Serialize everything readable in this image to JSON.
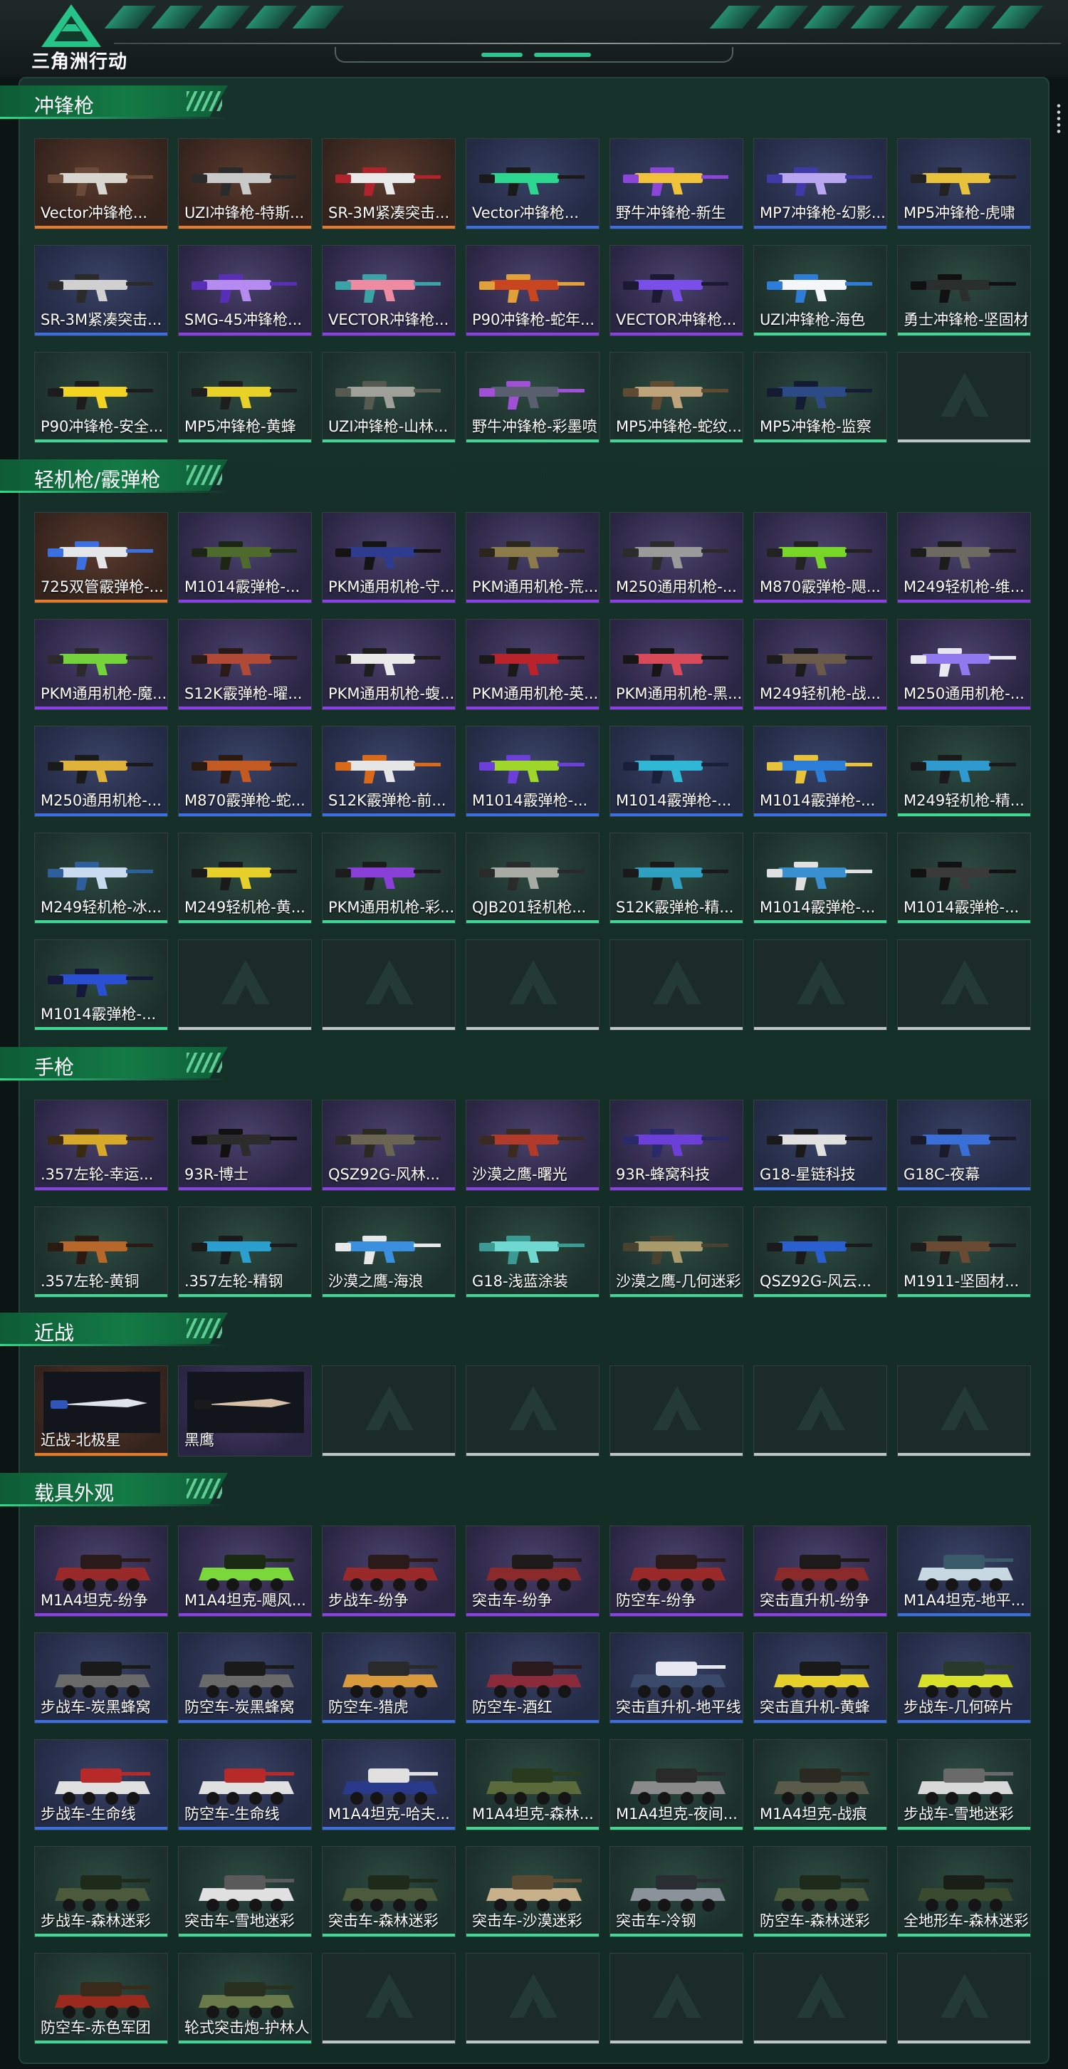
{
  "app": {
    "title": "三角洲行动"
  },
  "colors": {
    "purple": "#8a3fe8",
    "blue": "#3a6fe4",
    "green": "#3ed793",
    "orange": "#e57b2b",
    "accent": "#137a45"
  },
  "sections": [
    {
      "title": "冲锋枪",
      "type": "gun",
      "items": [
        {
          "label": "Vector冲锋枪...",
          "rarity": "orange",
          "palette": [
            "#d8d6cf",
            "#6b4a3a"
          ]
        },
        {
          "label": "UZI冲锋枪-特斯...",
          "rarity": "orange",
          "palette": [
            "#c9c9c9",
            "#2b2b2b"
          ]
        },
        {
          "label": "SR-3M紧凑突击...",
          "rarity": "orange",
          "palette": [
            "#e8e8e8",
            "#b0232a"
          ]
        },
        {
          "label": "Vector冲锋枪...",
          "rarity": "blue",
          "palette": [
            "#2dd68f",
            "#1a1a1a"
          ]
        },
        {
          "label": "野牛冲锋枪-新生",
          "rarity": "blue",
          "palette": [
            "#f0c23a",
            "#8b45d8"
          ]
        },
        {
          "label": "MP7冲锋枪-幻影...",
          "rarity": "blue",
          "palette": [
            "#b8a6f0",
            "#3f3aa8"
          ]
        },
        {
          "label": "MP5冲锋枪-虎啸",
          "rarity": "blue",
          "palette": [
            "#e9c23b",
            "#222222"
          ]
        },
        {
          "label": "SR-3M紧凑突击...",
          "rarity": "blue",
          "palette": [
            "#d0d0d0",
            "#2a2a2a"
          ]
        },
        {
          "label": "SMG-45冲锋枪...",
          "rarity": "purple",
          "palette": [
            "#b58bf2",
            "#5a2fb8"
          ]
        },
        {
          "label": "VECTOR冲锋枪...",
          "rarity": "purple",
          "palette": [
            "#ef8aa3",
            "#3aa3a8"
          ]
        },
        {
          "label": "P90冲锋枪-蛇年...",
          "rarity": "purple",
          "palette": [
            "#c8461f",
            "#e2a03a"
          ]
        },
        {
          "label": "VECTOR冲锋枪...",
          "rarity": "purple",
          "palette": [
            "#7a4ee8",
            "#1c1a33"
          ]
        },
        {
          "label": "UZI冲锋枪-海色",
          "rarity": "green",
          "palette": [
            "#f4f6f8",
            "#2e7bd8"
          ]
        },
        {
          "label": "勇士冲锋枪-坚固材...",
          "rarity": "green",
          "palette": [
            "#2a2e2c",
            "#111111"
          ]
        },
        {
          "label": "P90冲锋枪-安全...",
          "rarity": "green",
          "palette": [
            "#f3d322",
            "#1c1c1c"
          ]
        },
        {
          "label": "MP5冲锋枪-黄蜂",
          "rarity": "green",
          "palette": [
            "#e8d228",
            "#1e1e1e"
          ]
        },
        {
          "label": "UZI冲锋枪-山林...",
          "rarity": "green",
          "palette": [
            "#9fa09a",
            "#565a50"
          ]
        },
        {
          "label": "野牛冲锋枪-彩墨喷...",
          "rarity": "green",
          "palette": [
            "#5a5f70",
            "#a24fd8"
          ]
        },
        {
          "label": "MP5冲锋枪-蛇纹...",
          "rarity": "green",
          "palette": [
            "#bfa47b",
            "#5f4a32"
          ]
        },
        {
          "label": "MP5冲锋枪-监察",
          "rarity": "green",
          "palette": [
            "#2c4a86",
            "#131c33"
          ]
        },
        {
          "label": "",
          "rarity": "empty"
        }
      ]
    },
    {
      "title": "轻机枪/霰弹枪",
      "type": "gun",
      "items": [
        {
          "label": "725双管霰弹枪-...",
          "rarity": "orange",
          "palette": [
            "#e4e6ea",
            "#3c6fe0"
          ]
        },
        {
          "label": "M1014霰弹枪-...",
          "rarity": "purple",
          "palette": [
            "#4f6a2d",
            "#1d2615"
          ]
        },
        {
          "label": "PKM通用机枪-守...",
          "rarity": "purple",
          "palette": [
            "#2e3b8f",
            "#141414"
          ]
        },
        {
          "label": "PKM通用机枪-荒...",
          "rarity": "purple",
          "palette": [
            "#8b7a4a",
            "#2a261c"
          ]
        },
        {
          "label": "M250通用机枪-...",
          "rarity": "purple",
          "palette": [
            "#9a9a9a",
            "#2b2b2b"
          ]
        },
        {
          "label": "M870霰弹枪-飓...",
          "rarity": "purple",
          "palette": [
            "#78d628",
            "#222222"
          ]
        },
        {
          "label": "M249轻机枪-维...",
          "rarity": "purple",
          "palette": [
            "#6d6a62",
            "#1c1c1c"
          ]
        },
        {
          "label": "PKM通用机枪-魔...",
          "rarity": "purple",
          "palette": [
            "#74d23a",
            "#2a2a2a"
          ]
        },
        {
          "label": "S12K霰弹枪-曜...",
          "rarity": "purple",
          "palette": [
            "#b04a36",
            "#2a1a18"
          ]
        },
        {
          "label": "PKM通用机枪-蝮...",
          "rarity": "purple",
          "palette": [
            "#e9e9e9",
            "#1e1e1e"
          ]
        },
        {
          "label": "PKM通用机枪-英...",
          "rarity": "purple",
          "palette": [
            "#b8232c",
            "#1a1a1a"
          ]
        },
        {
          "label": "PKM通用机枪-黑...",
          "rarity": "purple",
          "palette": [
            "#d84a5a",
            "#161616"
          ]
        },
        {
          "label": "M249轻机枪-战...",
          "rarity": "purple",
          "palette": [
            "#6a5a4a",
            "#1b1b1b"
          ]
        },
        {
          "label": "M250通用机枪-...",
          "rarity": "purple",
          "palette": [
            "#8f7af0",
            "#e8e8f0"
          ]
        },
        {
          "label": "M250通用机枪-...",
          "rarity": "blue",
          "palette": [
            "#e0b23a",
            "#1a1a1a"
          ]
        },
        {
          "label": "M870霰弹枪-蛇...",
          "rarity": "blue",
          "palette": [
            "#c25a22",
            "#2a1a12"
          ]
        },
        {
          "label": "S12K霰弹枪-前...",
          "rarity": "blue",
          "palette": [
            "#e6e6e6",
            "#d86a1a"
          ]
        },
        {
          "label": "M1014霰弹枪-...",
          "rarity": "blue",
          "palette": [
            "#9ed62a",
            "#6b3fd8"
          ]
        },
        {
          "label": "M1014霰弹枪-...",
          "rarity": "blue",
          "palette": [
            "#2fb8d6",
            "#1a1f3a"
          ]
        },
        {
          "label": "M1014霰弹枪-...",
          "rarity": "blue",
          "palette": [
            "#2b7ed8",
            "#e8c23a"
          ]
        },
        {
          "label": "M249轻机枪-精...",
          "rarity": "green",
          "palette": [
            "#2f9ad0",
            "#1a1a1a"
          ]
        },
        {
          "label": "M249轻机枪-冰...",
          "rarity": "green",
          "palette": [
            "#c9dcef",
            "#2f5f9a"
          ]
        },
        {
          "label": "M249轻机枪-黄...",
          "rarity": "green",
          "palette": [
            "#e8d02a",
            "#1a1a1a"
          ]
        },
        {
          "label": "PKM通用机枪-彩...",
          "rarity": "green",
          "palette": [
            "#8a3fd8",
            "#1c1c1c"
          ]
        },
        {
          "label": "QJB201轻机枪...",
          "rarity": "green",
          "palette": [
            "#a8aba4",
            "#2a2a2a"
          ]
        },
        {
          "label": "S12K霰弹枪-精...",
          "rarity": "green",
          "palette": [
            "#2f9fc2",
            "#1a1a1a"
          ]
        },
        {
          "label": "M1014霰弹枪-...",
          "rarity": "green",
          "palette": [
            "#3a8fd0",
            "#e0e0e0"
          ]
        },
        {
          "label": "M1014霰弹枪-...",
          "rarity": "green",
          "palette": [
            "#3a3a3a",
            "#121212"
          ]
        },
        {
          "label": "M1014霰弹枪-...",
          "rarity": "green",
          "palette": [
            "#2a4fd0",
            "#14183a"
          ]
        },
        {
          "label": "",
          "rarity": "empty"
        },
        {
          "label": "",
          "rarity": "empty"
        },
        {
          "label": "",
          "rarity": "empty"
        },
        {
          "label": "",
          "rarity": "empty"
        },
        {
          "label": "",
          "rarity": "empty"
        },
        {
          "label": "",
          "rarity": "empty"
        }
      ]
    },
    {
      "title": "手枪",
      "type": "gun",
      "items": [
        {
          "label": ".357左轮-幸运...",
          "rarity": "purple",
          "palette": [
            "#d8a82a",
            "#3a2a12"
          ]
        },
        {
          "label": "93R-博士",
          "rarity": "purple",
          "palette": [
            "#2c2c2c",
            "#111111"
          ]
        },
        {
          "label": "QSZ92G-风林...",
          "rarity": "purple",
          "palette": [
            "#6a6552",
            "#2a2a22"
          ]
        },
        {
          "label": "沙漠之鹰-曙光",
          "rarity": "purple",
          "palette": [
            "#b23a2a",
            "#3a2a22"
          ]
        },
        {
          "label": "93R-蜂窝科技",
          "rarity": "purple",
          "palette": [
            "#6b3fd8",
            "#2a2a6a"
          ]
        },
        {
          "label": "G18-星链科技",
          "rarity": "blue",
          "palette": [
            "#e0e0e0",
            "#1a1a1a"
          ]
        },
        {
          "label": "G18C-夜幕",
          "rarity": "blue",
          "palette": [
            "#3a6fd8",
            "#1a1a2a"
          ]
        },
        {
          "label": ".357左轮-黄铜",
          "rarity": "green",
          "palette": [
            "#b8672a",
            "#2a1a12"
          ]
        },
        {
          "label": ".357左轮-精钢",
          "rarity": "green",
          "palette": [
            "#2a9fd0",
            "#1a1a1a"
          ]
        },
        {
          "label": "沙漠之鹰-海浪",
          "rarity": "green",
          "palette": [
            "#3a8fe0",
            "#e8e8e8"
          ]
        },
        {
          "label": "G18-浅蓝涂装",
          "rarity": "green",
          "palette": [
            "#6fd8d0",
            "#3a9a94"
          ]
        },
        {
          "label": "沙漠之鹰-几何迷彩",
          "rarity": "green",
          "palette": [
            "#a89a6a",
            "#4a4230"
          ]
        },
        {
          "label": "QSZ92G-风云...",
          "rarity": "green",
          "palette": [
            "#2a5fd0",
            "#1a1a1a"
          ]
        },
        {
          "label": "M1911-坚固材...",
          "rarity": "green",
          "palette": [
            "#6a4a32",
            "#1c1c1c"
          ]
        }
      ]
    },
    {
      "title": "近战",
      "type": "knife",
      "items": [
        {
          "label": "近战-北极星",
          "rarity": "orange",
          "palette": [
            "#dfe4ea",
            "#2f55b8"
          ]
        },
        {
          "label": "黑鹰",
          "rarity": "",
          "palette": [
            "#d8c0a8",
            "#1a1a1a"
          ]
        },
        {
          "label": "",
          "rarity": "empty"
        },
        {
          "label": "",
          "rarity": "empty"
        },
        {
          "label": "",
          "rarity": "empty"
        },
        {
          "label": "",
          "rarity": "empty"
        },
        {
          "label": "",
          "rarity": "empty"
        }
      ]
    },
    {
      "title": "载具外观",
      "type": "vehicle",
      "items": [
        {
          "label": "M1A4坦克-纷争",
          "rarity": "purple",
          "palette": [
            "#9a2a2a",
            "#2a1a1a"
          ]
        },
        {
          "label": "M1A4坦克-飓风...",
          "rarity": "purple",
          "palette": [
            "#7ad83a",
            "#1a2a12"
          ]
        },
        {
          "label": "步战车-纷争",
          "rarity": "purple",
          "palette": [
            "#9a2a2a",
            "#2a1a1a"
          ]
        },
        {
          "label": "突击车-纷争",
          "rarity": "purple",
          "palette": [
            "#8a2a2a",
            "#1e1a1a"
          ]
        },
        {
          "label": "防空车-纷争",
          "rarity": "purple",
          "palette": [
            "#9a2a2a",
            "#2a1a1a"
          ]
        },
        {
          "label": "突击直升机-纷争",
          "rarity": "purple",
          "palette": [
            "#8a2a2a",
            "#1e1a1a"
          ]
        },
        {
          "label": "M1A4坦克-地平...",
          "rarity": "blue",
          "palette": [
            "#c8d8e0",
            "#3a5a6a"
          ]
        },
        {
          "label": "步战车-炭黑蜂窝",
          "rarity": "blue",
          "palette": [
            "#6a6a6a",
            "#1a1a1a"
          ]
        },
        {
          "label": "防空车-炭黑蜂窝",
          "rarity": "blue",
          "palette": [
            "#6a6a6a",
            "#1a1a1a"
          ]
        },
        {
          "label": "防空车-猎虎",
          "rarity": "blue",
          "palette": [
            "#d89a3a",
            "#2a2a2a"
          ]
        },
        {
          "label": "防空车-酒红",
          "rarity": "blue",
          "palette": [
            "#8a2a3a",
            "#2a1a1e"
          ]
        },
        {
          "label": "突击直升机-地平线",
          "rarity": "blue",
          "palette": [
            "#3a4a6a",
            "#e8e8f0"
          ]
        },
        {
          "label": "突击直升机-黄蜂",
          "rarity": "blue",
          "palette": [
            "#e8d02a",
            "#1a1a1a"
          ]
        },
        {
          "label": "步战车-几何碎片",
          "rarity": "blue",
          "palette": [
            "#d8e02a",
            "#2a3a2a"
          ]
        },
        {
          "label": "步战车-生命线",
          "rarity": "blue",
          "palette": [
            "#e0e0e0",
            "#b82a2a"
          ]
        },
        {
          "label": "防空车-生命线",
          "rarity": "blue",
          "palette": [
            "#e0e0e0",
            "#b82a2a"
          ]
        },
        {
          "label": "M1A4坦克-哈夫...",
          "rarity": "blue",
          "palette": [
            "#2a3a8a",
            "#e0e0e0"
          ]
        },
        {
          "label": "M1A4坦克-森林...",
          "rarity": "green",
          "palette": [
            "#5a6a3a",
            "#2a3a1e"
          ]
        },
        {
          "label": "M1A4坦克-夜间...",
          "rarity": "green",
          "palette": [
            "#8a8a8a",
            "#2a2a2a"
          ]
        },
        {
          "label": "M1A4坦克-战痕",
          "rarity": "green",
          "palette": [
            "#5a5a4a",
            "#2a2a22"
          ]
        },
        {
          "label": "步战车-雪地迷彩",
          "rarity": "green",
          "palette": [
            "#d8d8d8",
            "#6a6a6a"
          ]
        },
        {
          "label": "步战车-森林迷彩",
          "rarity": "green",
          "palette": [
            "#4a5a3a",
            "#1e2a1a"
          ]
        },
        {
          "label": "突击车-雪地迷彩",
          "rarity": "green",
          "palette": [
            "#e0e0e0",
            "#5a5a5a"
          ]
        },
        {
          "label": "突击车-森林迷彩",
          "rarity": "green",
          "palette": [
            "#4a5a3a",
            "#1e2a1a"
          ]
        },
        {
          "label": "突击车-沙漠迷彩",
          "rarity": "green",
          "palette": [
            "#c8b08a",
            "#5a4a32"
          ]
        },
        {
          "label": "突击车-冷钢",
          "rarity": "green",
          "palette": [
            "#8a929a",
            "#2a2e32"
          ]
        },
        {
          "label": "防空车-森林迷彩",
          "rarity": "green",
          "palette": [
            "#4a5a3a",
            "#1e2a1a"
          ]
        },
        {
          "label": "全地形车-森林迷彩",
          "rarity": "green",
          "palette": [
            "#3a4a2e",
            "#1a1e16"
          ]
        },
        {
          "label": "防空车-赤色军团",
          "rarity": "green",
          "palette": [
            "#9a2a1e",
            "#3a2a1a"
          ]
        },
        {
          "label": "轮式突击炮-护林人",
          "rarity": "green",
          "palette": [
            "#6a7a4a",
            "#2a3020"
          ]
        },
        {
          "label": "",
          "rarity": "empty"
        },
        {
          "label": "",
          "rarity": "empty"
        },
        {
          "label": "",
          "rarity": "empty"
        },
        {
          "label": "",
          "rarity": "empty"
        },
        {
          "label": "",
          "rarity": "empty"
        }
      ]
    }
  ]
}
